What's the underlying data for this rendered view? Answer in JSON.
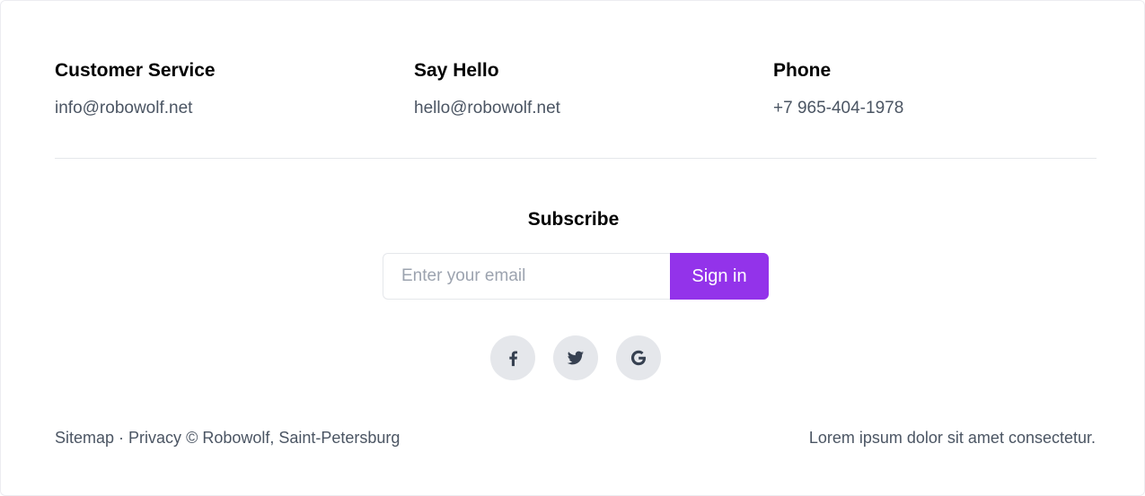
{
  "contacts": [
    {
      "title": "Customer Service",
      "value": "info@robowolf.net"
    },
    {
      "title": "Say Hello",
      "value": "hello@robowolf.net"
    },
    {
      "title": "Phone",
      "value": "+7 965-404-1978"
    }
  ],
  "subscribe": {
    "title": "Subscribe",
    "email_placeholder": "Enter your email",
    "email_value": "",
    "button_label": "Sign in"
  },
  "social": [
    {
      "name": "facebook-icon",
      "label": "Facebook"
    },
    {
      "name": "twitter-icon",
      "label": "Twitter"
    },
    {
      "name": "google-icon",
      "label": "Google"
    }
  ],
  "footer": {
    "sitemap_label": "Sitemap",
    "separator": " · ",
    "privacy_label": "Privacy",
    "copyright": " © Robowolf, Saint-Petersburg",
    "tagline": "Lorem ipsum dolor sit amet consectetur."
  },
  "colors": {
    "accent": "#9333ea",
    "muted_text": "#4b5563",
    "social_bg": "#e5e7eb",
    "divider": "#e5e7eb"
  }
}
